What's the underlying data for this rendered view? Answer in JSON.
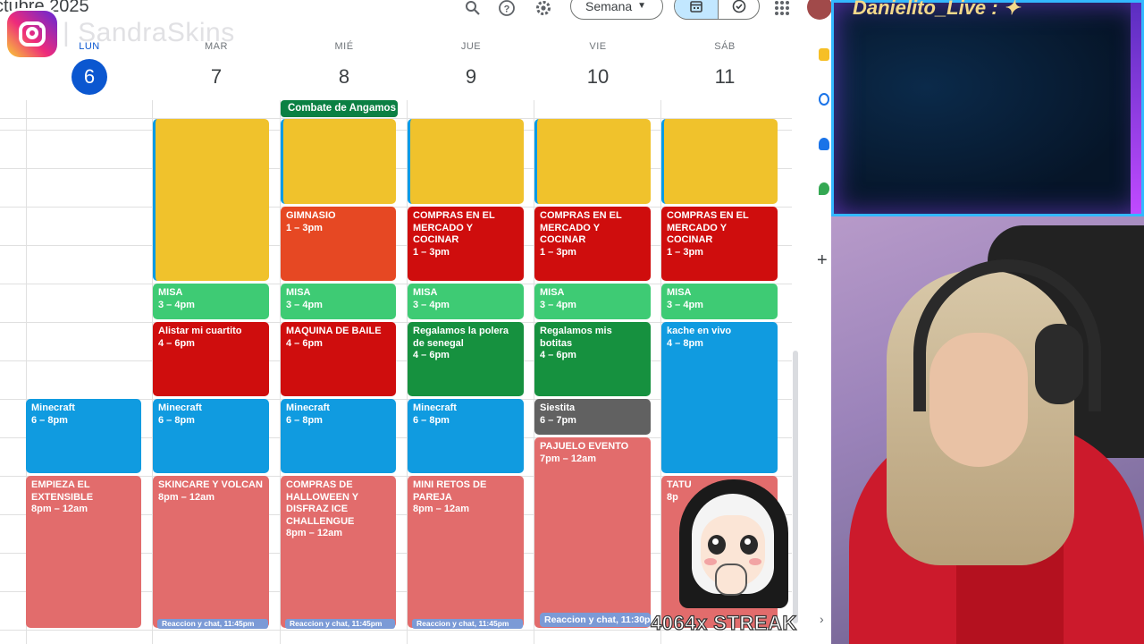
{
  "header": {
    "month_title": "ctubre 2025",
    "view_selector": "Semana",
    "icons": [
      "search-icon",
      "help-icon",
      "settings-icon",
      "calendar-view-icon",
      "tasks-view-icon",
      "apps-grid-icon"
    ]
  },
  "overlay": {
    "instagram_handle": "SandraSkins",
    "streamer_name": "Danielito_Live :",
    "streak_text": "4064x STREAK"
  },
  "days": [
    {
      "name": "LUN",
      "number": "6",
      "today": true
    },
    {
      "name": "MAR",
      "number": "7"
    },
    {
      "name": "MIÉ",
      "number": "8"
    },
    {
      "name": "JUE",
      "number": "9"
    },
    {
      "name": "VIE",
      "number": "10"
    },
    {
      "name": "SÁB",
      "number": "11"
    }
  ],
  "all_day_event": "Combate de Angamos",
  "events": {
    "gym": {
      "title": "GIMNASIO",
      "time": "1 – 3pm"
    },
    "compras": {
      "title": "COMPRAS EN EL MERCADO Y COCINAR",
      "time": "1 – 3pm"
    },
    "misa": {
      "title": "MISA",
      "time": "3 – 4pm"
    },
    "alistar": {
      "title": "Alistar mi cuartito",
      "time": "4 – 6pm"
    },
    "maquina": {
      "title": "MAQUINA DE BAILE",
      "time": "4 – 6pm"
    },
    "polera": {
      "title": "Regalamos la polera de senegal",
      "time": "4 – 6pm"
    },
    "botitas": {
      "title": "Regalamos mis botitas",
      "time": "4 – 6pm"
    },
    "kache": {
      "title": "kache en vivo",
      "time": "4 – 8pm"
    },
    "minecraft": {
      "title": "Minecraft",
      "time": "6 – 8pm"
    },
    "siestita": {
      "title": "Siestita",
      "time": "6 – 7pm"
    },
    "pajuelo": {
      "title": "PAJUELO EVENTO",
      "time": "7pm – 12am"
    },
    "extensible": {
      "title": "EMPIEZA EL EXTENSIBLE",
      "time": "8pm – 12am"
    },
    "skincare": {
      "title": "SKINCARE Y VOLCAN",
      "time": "8pm – 12am"
    },
    "halloween": {
      "title": "COMPRAS DE HALLOWEEN Y DISFRAZ ICE CHALLENGUE",
      "time": "8pm – 12am"
    },
    "retos": {
      "title": "MINI RETOS DE PAREJA",
      "time": "8pm – 12am"
    },
    "tatu": {
      "title": "TATU",
      "time": "8p"
    },
    "reaccion_small": "Reaccion y chat, 11:45pm",
    "reaccion_vie": "Reaccion y chat, 11:30p"
  }
}
